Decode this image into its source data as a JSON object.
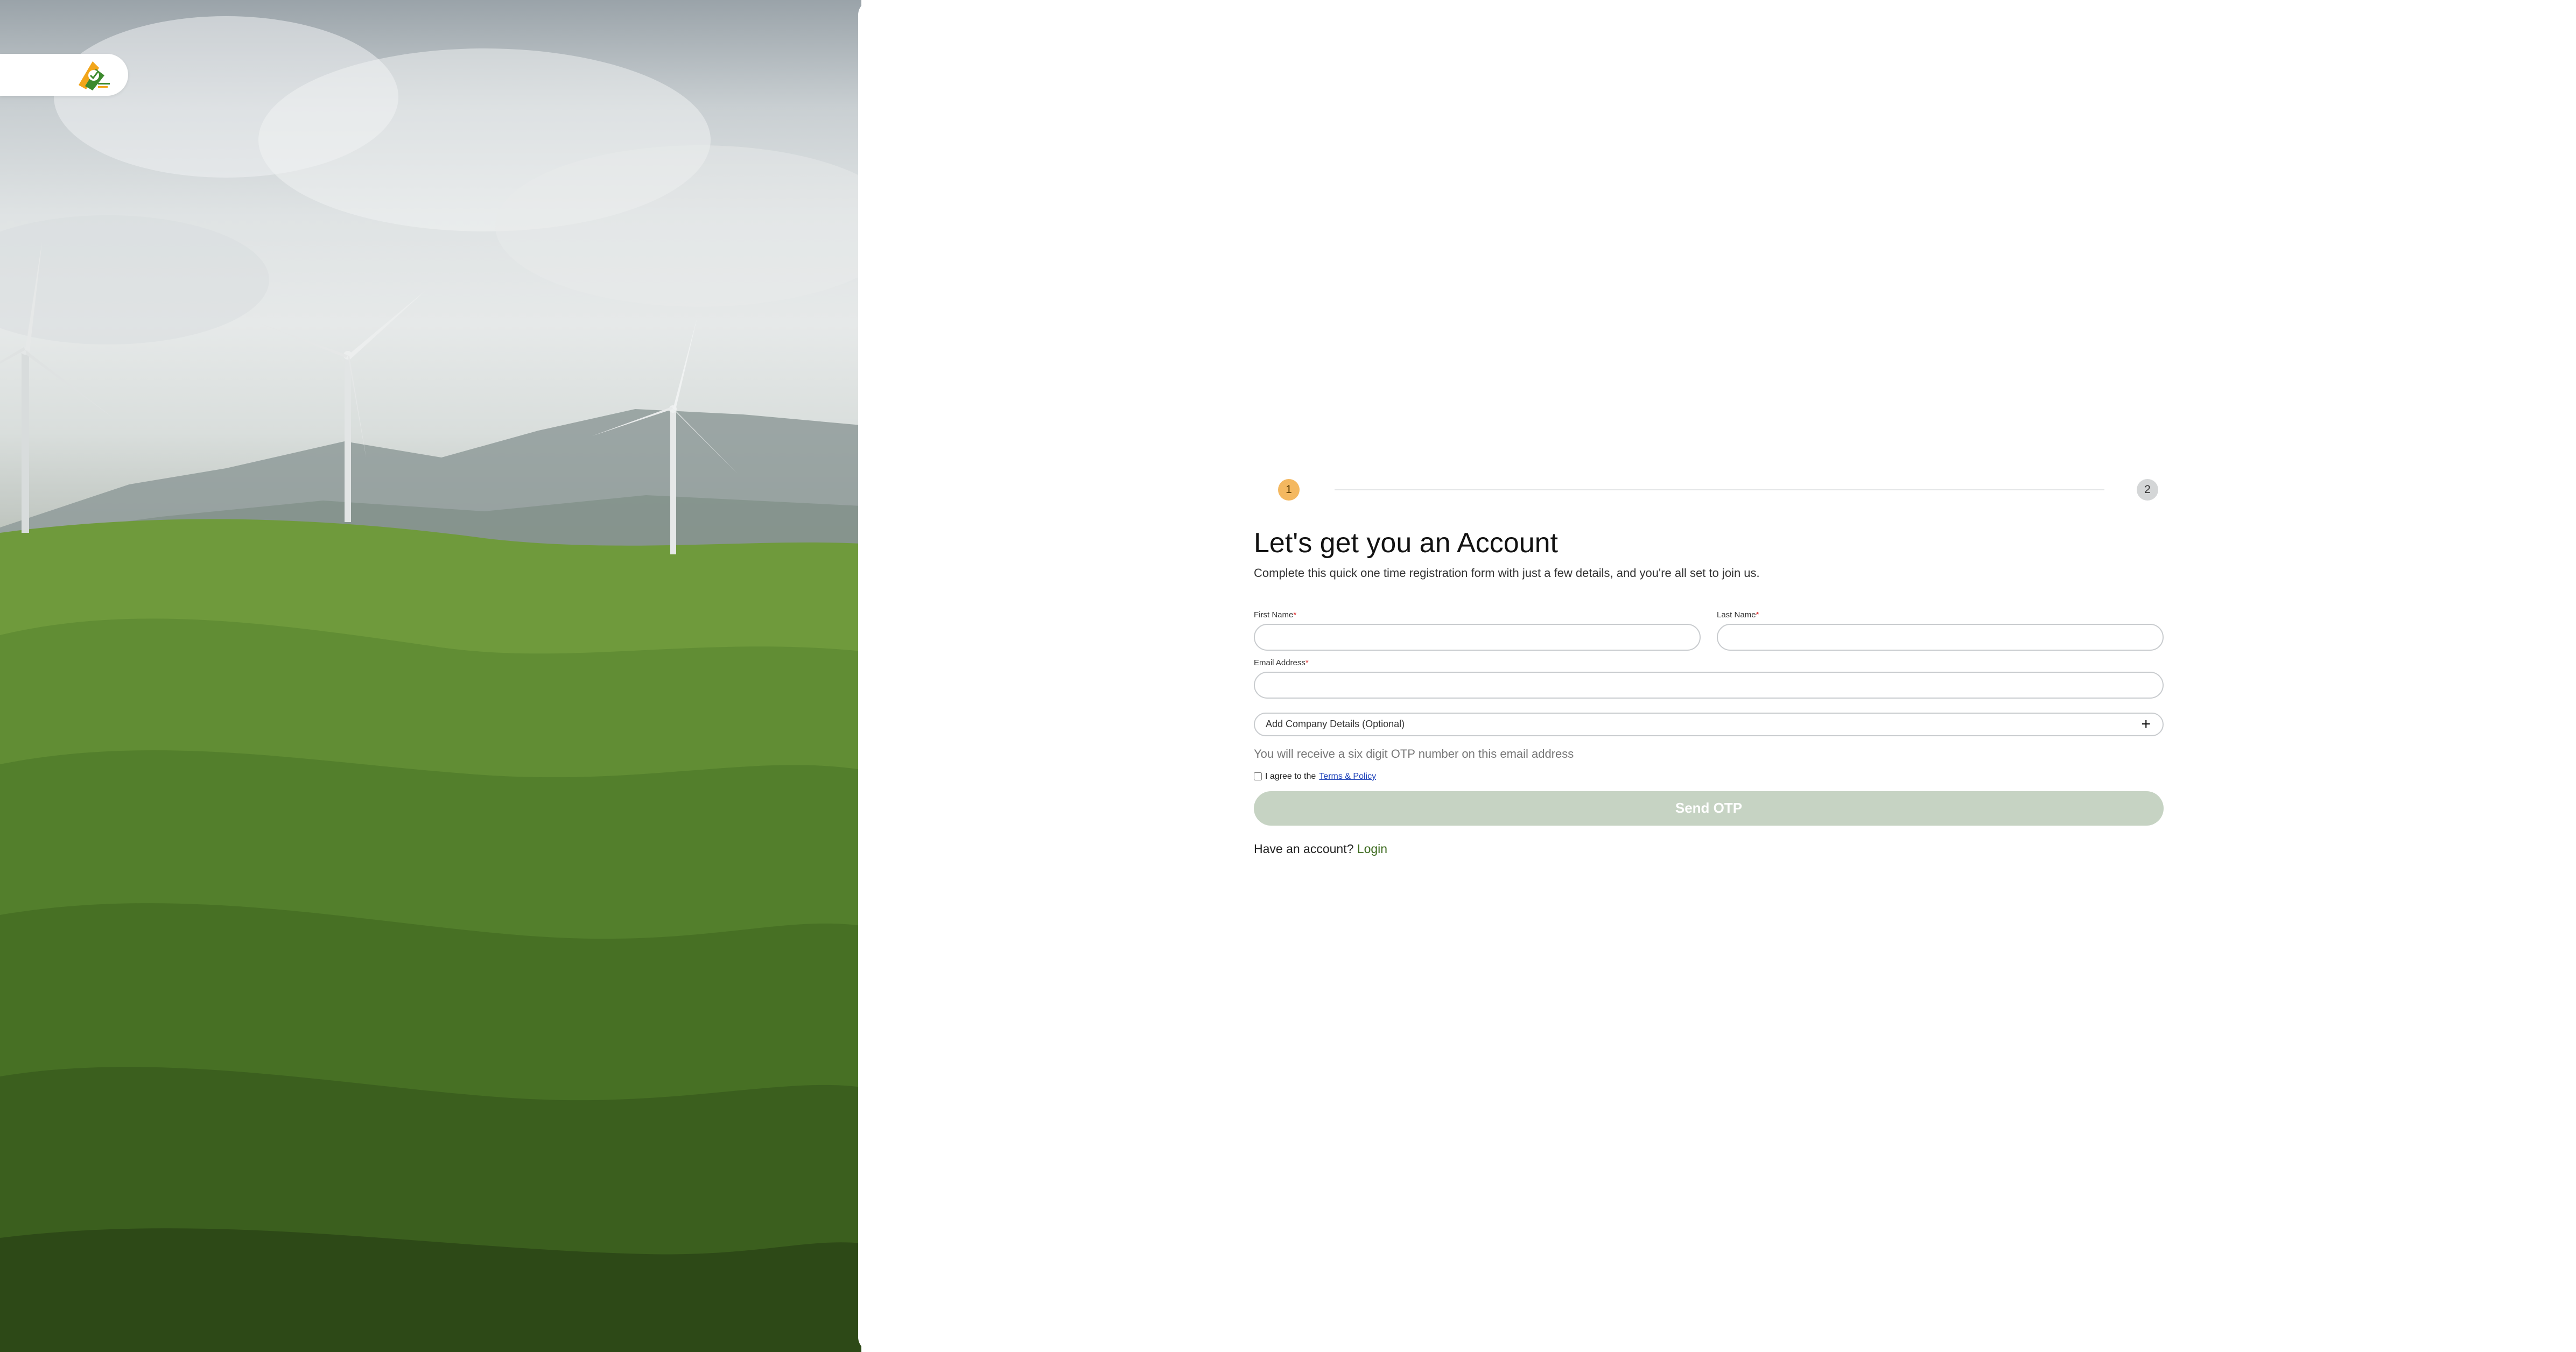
{
  "stepper": {
    "step1": "1",
    "step2": "2"
  },
  "form": {
    "title": "Let's get you an Account",
    "subtitle": "Complete this quick one time registration form with just a few details, and you're all set to join us.",
    "first_name": {
      "label": "First Name",
      "required_mark": "*",
      "value": "",
      "placeholder": ""
    },
    "last_name": {
      "label": "Last Name",
      "required_mark": "*",
      "value": "",
      "placeholder": ""
    },
    "email": {
      "label": "Email Address",
      "required_mark": "*",
      "value": "",
      "placeholder": ""
    },
    "company_toggle": {
      "label": "Add Company Details (Optional)",
      "icon": "plus-icon"
    },
    "otp_note": "You will receive a six digit OTP number on this email address",
    "agree": {
      "prefix": "I agree to the ",
      "link": "Terms & Policy",
      "checked": false
    },
    "send_button": "Send OTP",
    "footer": {
      "prompt": "Have an account? ",
      "link": "Login"
    }
  },
  "colors": {
    "step_active": "#f4b860",
    "step_inactive": "#d4d6d7",
    "button_disabled": "#c6d3c3",
    "link_green": "#3c6a1e",
    "link_blue": "#1a3fb8"
  }
}
